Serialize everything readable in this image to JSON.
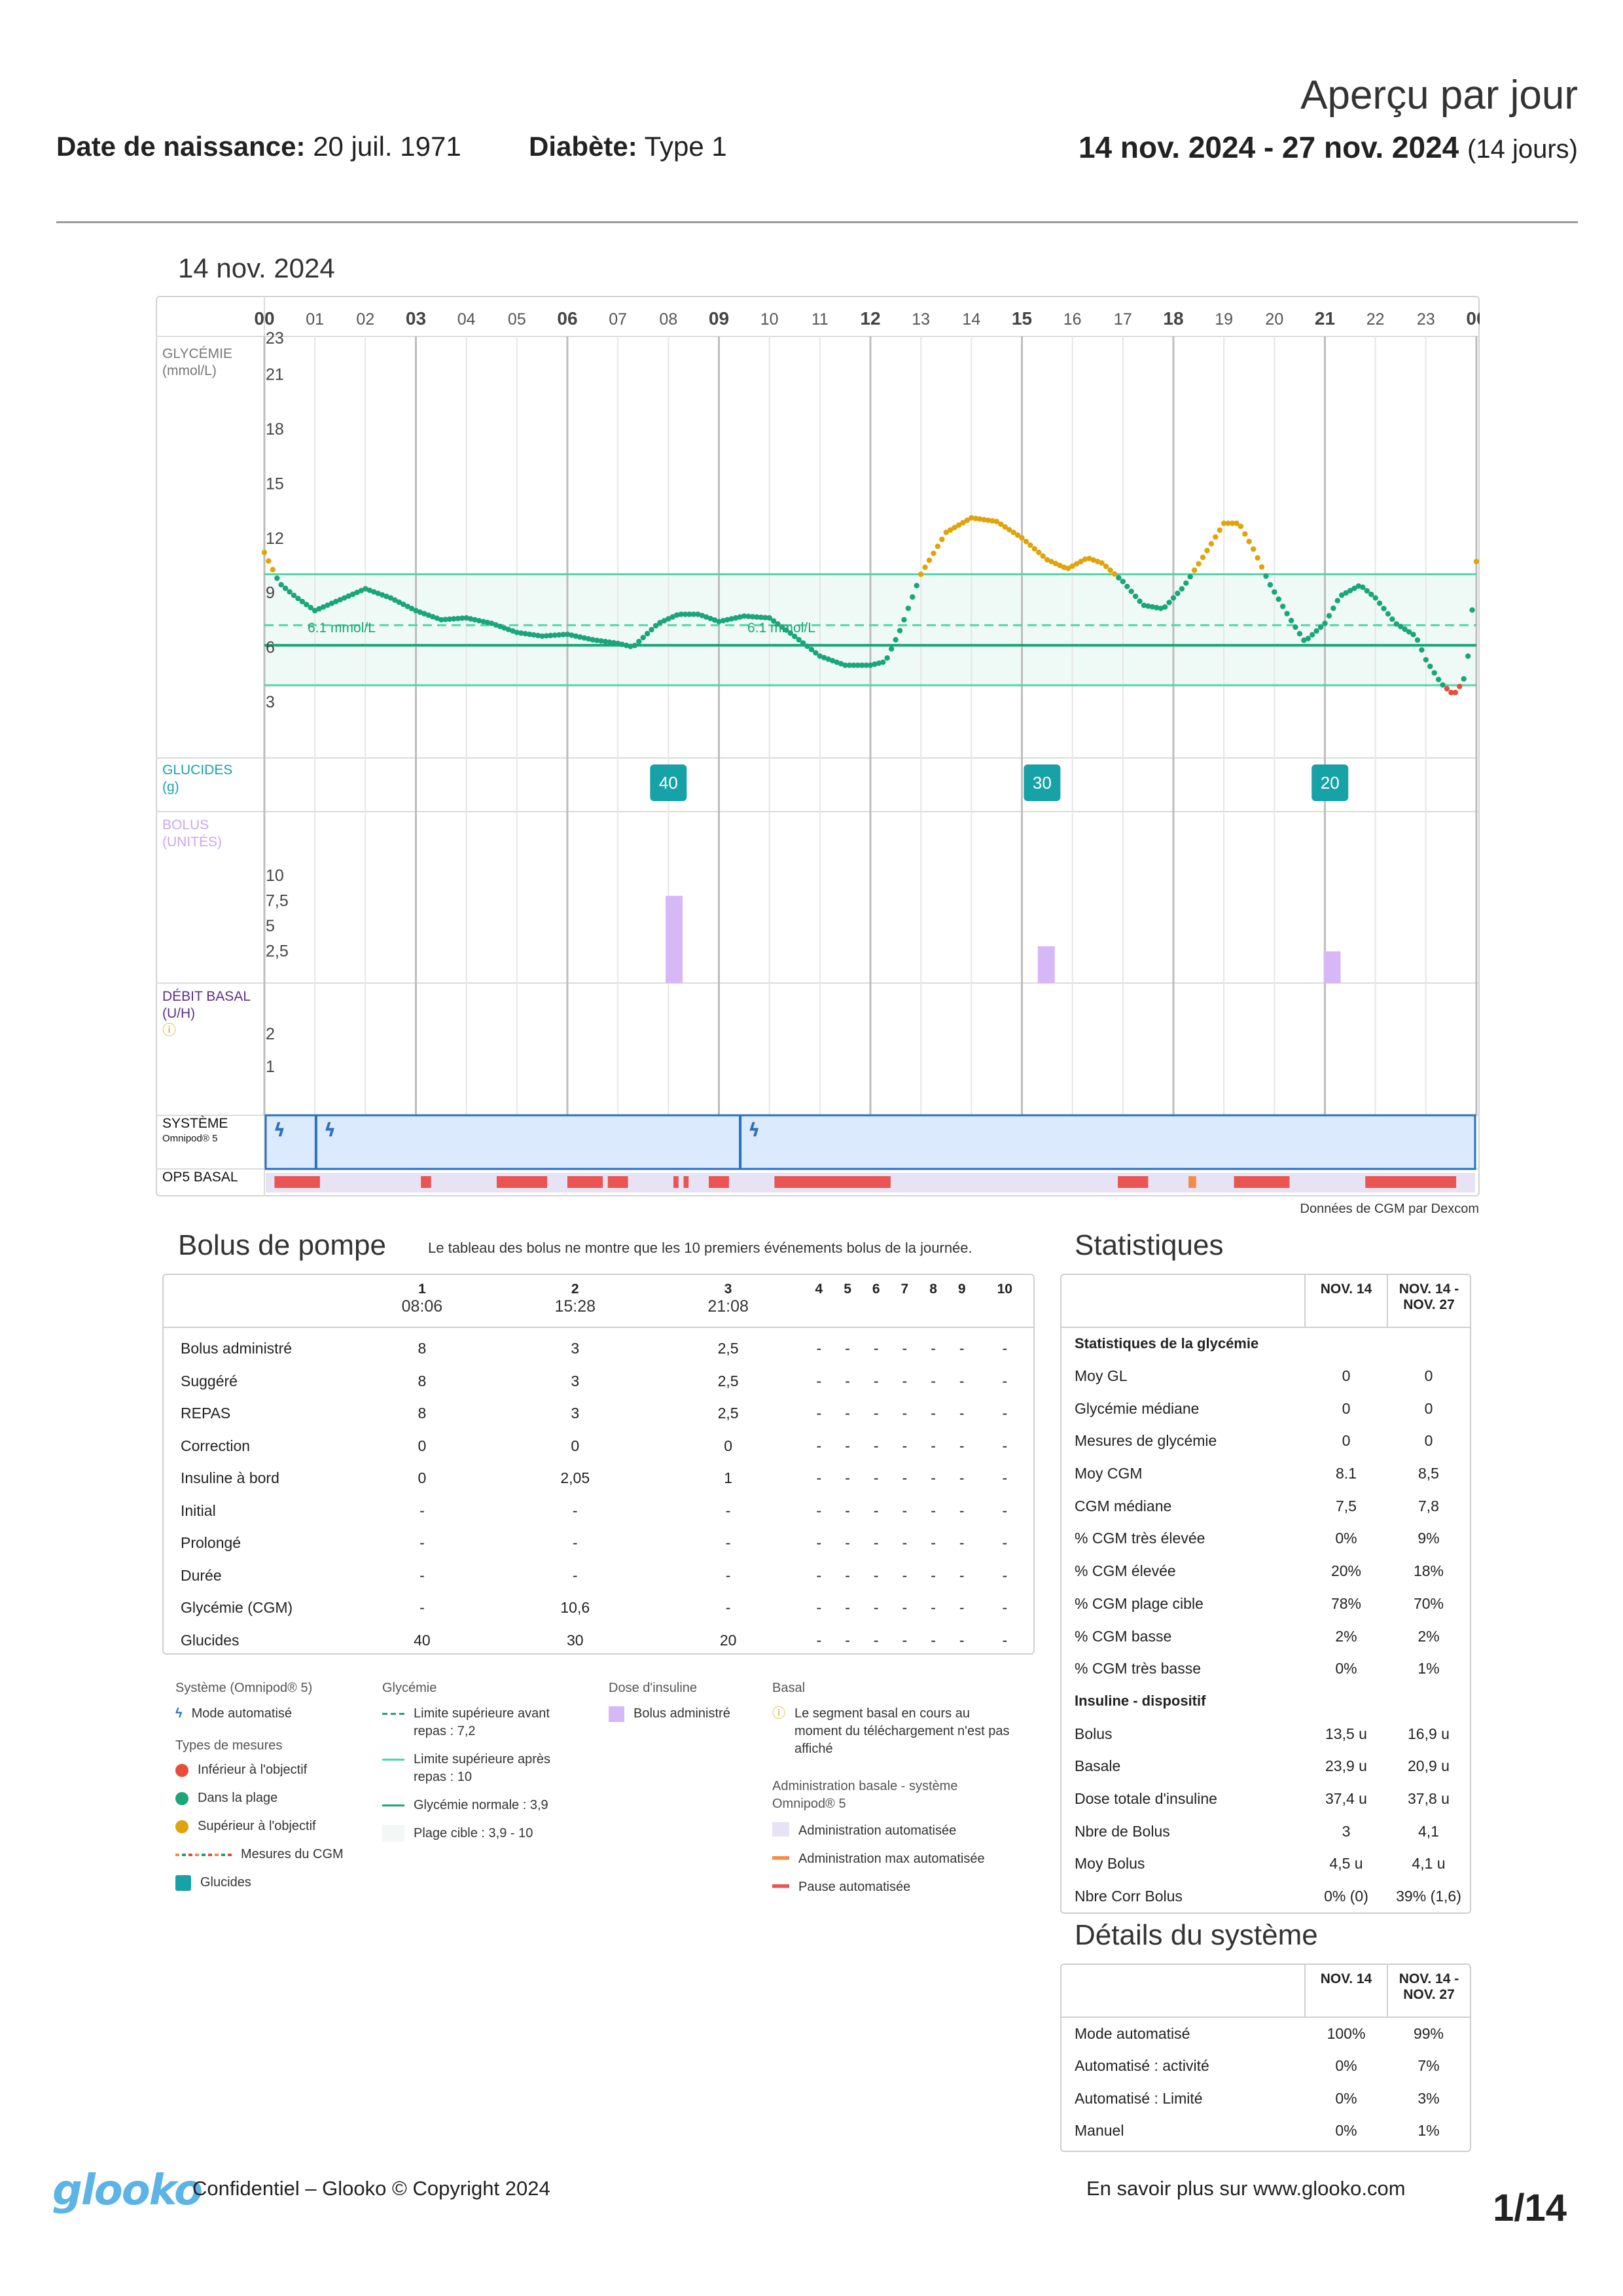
{
  "header": {
    "title": "Aperçu par jour",
    "dob_label": "Date de naissance:",
    "dob_value": "20 juil. 1971",
    "diabetes_label": "Diabète:",
    "diabetes_value": "Type 1",
    "range": "14 nov. 2024 - 27 nov. 2024",
    "range_days": "(14 jours)"
  },
  "day": {
    "title": "14 nov. 2024"
  },
  "chart": {
    "rows": {
      "glycemia": "GLYCÉMIE",
      "glycemia_unit": "(mmol/L)",
      "carbs": "GLUCIDES",
      "carbs_unit": "(g)",
      "bolus": "BOLUS",
      "bolus_unit": "(UNITÉS)",
      "basal": "DÉBIT BASAL",
      "basal_unit": "(U/H)",
      "system": "SYSTÈME",
      "system_sub": "Omnipod® 5",
      "op5": "OP5 BASAL"
    },
    "target_label_1": "6.1 mmol/L",
    "target_label_2": "6.1 mmol/L",
    "source": "Données de CGM par Dexcom",
    "colors": {
      "in_range": "#1aa57a",
      "above": "#e0a30a",
      "below": "#e84c3d",
      "carbs": "#17a2a8",
      "bolus": "#d5b8f5",
      "system": "#dbeafc",
      "system_border": "#2a6fc1",
      "pause": "#ea5452",
      "max": "#f28c46",
      "basal_bg": "#e7e3f4"
    }
  },
  "chart_data": {
    "type": "scatter",
    "x_ticks": [
      "00",
      "01",
      "02",
      "03",
      "04",
      "05",
      "06",
      "07",
      "08",
      "09",
      "10",
      "11",
      "12",
      "13",
      "14",
      "15",
      "16",
      "17",
      "18",
      "19",
      "20",
      "21",
      "22",
      "23",
      "00"
    ],
    "y_ticks": [
      "3",
      "6",
      "9",
      "12",
      "15",
      "18",
      "21",
      "23"
    ],
    "ylim": [
      0,
      23
    ],
    "target_range": [
      3.9,
      10
    ],
    "glucose_curve": [
      [
        0,
        11.2
      ],
      [
        0.3,
        9.5
      ],
      [
        0.6,
        8.8
      ],
      [
        1,
        8
      ],
      [
        1.5,
        8.6
      ],
      [
        2,
        9.2
      ],
      [
        2.5,
        8.7
      ],
      [
        3,
        8
      ],
      [
        3.5,
        7.5
      ],
      [
        4,
        7.6
      ],
      [
        4.5,
        7.3
      ],
      [
        5,
        6.8
      ],
      [
        5.5,
        6.6
      ],
      [
        6,
        6.7
      ],
      [
        6.5,
        6.4
      ],
      [
        7,
        6.2
      ],
      [
        7.3,
        6
      ],
      [
        7.8,
        7.3
      ],
      [
        8.2,
        7.8
      ],
      [
        8.6,
        7.8
      ],
      [
        9,
        7.4
      ],
      [
        9.5,
        7.7
      ],
      [
        10,
        7.6
      ],
      [
        10.4,
        6.8
      ],
      [
        11,
        5.5
      ],
      [
        11.5,
        5
      ],
      [
        12,
        5
      ],
      [
        12.3,
        5.2
      ],
      [
        12.6,
        7
      ],
      [
        13,
        10
      ],
      [
        13.5,
        12.3
      ],
      [
        14,
        13.1
      ],
      [
        14.5,
        12.9
      ],
      [
        15,
        12
      ],
      [
        15.5,
        10.8
      ],
      [
        15.9,
        10.3
      ],
      [
        16.3,
        10.9
      ],
      [
        16.6,
        10.6
      ],
      [
        17,
        9.6
      ],
      [
        17.4,
        8.3
      ],
      [
        17.8,
        8.1
      ],
      [
        18.2,
        9.3
      ],
      [
        18.6,
        11
      ],
      [
        19,
        12.8
      ],
      [
        19.3,
        12.8
      ],
      [
        19.6,
        11.3
      ],
      [
        19.9,
        9.5
      ],
      [
        20.3,
        7.6
      ],
      [
        20.6,
        6.3
      ],
      [
        21,
        7.3
      ],
      [
        21.3,
        8.8
      ],
      [
        21.7,
        9.4
      ],
      [
        22,
        8.7
      ],
      [
        22.4,
        7.3
      ],
      [
        22.8,
        6.6
      ],
      [
        23,
        5.3
      ],
      [
        23.3,
        4
      ],
      [
        23.5,
        3.5
      ],
      [
        23.6,
        3.5
      ],
      [
        23.8,
        4.5
      ],
      [
        23.9,
        7.5
      ],
      [
        24,
        10.7
      ]
    ],
    "carbs": [
      {
        "hour": 8.0,
        "value": "40"
      },
      {
        "hour": 15.4,
        "value": "30"
      },
      {
        "hour": 21.1,
        "value": "20"
      }
    ],
    "bolus_ticks": [
      "10",
      "7,5",
      "5",
      "2,5"
    ],
    "bolus": [
      {
        "hour": 8.1,
        "units": 8
      },
      {
        "hour": 15.47,
        "units": 3
      },
      {
        "hour": 21.13,
        "units": 2.5
      }
    ],
    "basal_ticks": [
      "2",
      "1"
    ],
    "auto_mode_markers": [
      0.1,
      1.1,
      9.5
    ],
    "op5_pauses": [
      [
        0.2,
        1.1
      ],
      [
        3.1,
        3.3
      ],
      [
        4.6,
        5.6
      ],
      [
        6,
        6.7
      ],
      [
        6.8,
        7.2
      ],
      [
        8.1,
        8.2
      ],
      [
        8.3,
        8.4
      ],
      [
        8.8,
        9.2
      ],
      [
        10.1,
        12.4
      ],
      [
        16.9,
        17.5
      ],
      [
        21.8,
        23.6
      ],
      [
        19.2,
        20.3
      ]
    ],
    "op5_max": [
      [
        18.3,
        18.45
      ]
    ]
  },
  "bolus_table": {
    "title": "Bolus de pompe",
    "note": "Le tableau des bolus ne montre que les 10 premiers événements bolus de la journée.",
    "columns": [
      "1",
      "2",
      "3",
      "4",
      "5",
      "6",
      "7",
      "8",
      "9",
      "10"
    ],
    "times": [
      "08:06",
      "15:28",
      "21:08",
      "",
      "",
      "",
      "",
      "",
      "",
      ""
    ],
    "rows": [
      {
        "label": "Bolus administré",
        "values": [
          "8",
          "3",
          "2,5",
          "-",
          "-",
          "-",
          "-",
          "-",
          "-",
          "-"
        ]
      },
      {
        "label": "Suggéré",
        "values": [
          "8",
          "3",
          "2,5",
          "-",
          "-",
          "-",
          "-",
          "-",
          "-",
          "-"
        ]
      },
      {
        "label": "REPAS",
        "values": [
          "8",
          "3",
          "2,5",
          "-",
          "-",
          "-",
          "-",
          "-",
          "-",
          "-"
        ]
      },
      {
        "label": "Correction",
        "values": [
          "0",
          "0",
          "0",
          "-",
          "-",
          "-",
          "-",
          "-",
          "-",
          "-"
        ]
      },
      {
        "label": "Insuline à bord",
        "values": [
          "0",
          "2,05",
          "1",
          "-",
          "-",
          "-",
          "-",
          "-",
          "-",
          "-"
        ]
      },
      {
        "label": "Initial",
        "values": [
          "-",
          "-",
          "-",
          "-",
          "-",
          "-",
          "-",
          "-",
          "-",
          "-"
        ]
      },
      {
        "label": "Prolongé",
        "values": [
          "-",
          "-",
          "-",
          "-",
          "-",
          "-",
          "-",
          "-",
          "-",
          "-"
        ]
      },
      {
        "label": "Durée",
        "values": [
          "-",
          "-",
          "-",
          "-",
          "-",
          "-",
          "-",
          "-",
          "-",
          "-"
        ]
      },
      {
        "label": "Glycémie (CGM)",
        "values": [
          "-",
          "10,6",
          "-",
          "-",
          "-",
          "-",
          "-",
          "-",
          "-",
          "-"
        ]
      },
      {
        "label": "Glucides",
        "values": [
          "40",
          "30",
          "20",
          "-",
          "-",
          "-",
          "-",
          "-",
          "-",
          "-"
        ]
      }
    ]
  },
  "stats": {
    "title": "Statistiques",
    "col1": "NOV. 14",
    "col2a": "NOV. 14 -",
    "col2b": "NOV. 27",
    "rows": [
      {
        "label": "Statistiques de la glycémie",
        "a": "",
        "b": "",
        "head": true
      },
      {
        "label": "Moy GL",
        "a": "0",
        "b": "0"
      },
      {
        "label": "Glycémie médiane",
        "a": "0",
        "b": "0"
      },
      {
        "label": "Mesures de glycémie",
        "a": "0",
        "b": "0"
      },
      {
        "label": "Moy CGM",
        "a": "8.1",
        "b": "8,5"
      },
      {
        "label": "CGM médiane",
        "a": "7,5",
        "b": "7,8"
      },
      {
        "label": "% CGM très élevée",
        "a": "0%",
        "b": "9%"
      },
      {
        "label": "% CGM élevée",
        "a": "20%",
        "b": "18%"
      },
      {
        "label": "% CGM plage cible",
        "a": "78%",
        "b": "70%"
      },
      {
        "label": "% CGM basse",
        "a": "2%",
        "b": "2%"
      },
      {
        "label": "% CGM très basse",
        "a": "0%",
        "b": "1%"
      },
      {
        "label": "Insuline - dispositif",
        "a": "",
        "b": "",
        "head": true
      },
      {
        "label": "Bolus",
        "a": "13,5 u",
        "b": "16,9 u"
      },
      {
        "label": "Basale",
        "a": "23,9 u",
        "b": "20,9 u"
      },
      {
        "label": "Dose totale d'insuline",
        "a": "37,4 u",
        "b": "37,8 u"
      },
      {
        "label": "Nbre de Bolus",
        "a": "3",
        "b": "4,1"
      },
      {
        "label": "Moy Bolus",
        "a": "4,5 u",
        "b": "4,1 u"
      },
      {
        "label": "Nbre Corr Bolus",
        "a": "0% (0)",
        "b": "39% (1,6)"
      }
    ]
  },
  "system_details": {
    "title": "Détails du système",
    "col1": "NOV. 14",
    "col2a": "NOV. 14 -",
    "col2b": "NOV. 27",
    "rows": [
      {
        "label": "Mode automatisé",
        "a": "100%",
        "b": "99%"
      },
      {
        "label": "Automatisé : activité",
        "a": "0%",
        "b": "7%"
      },
      {
        "label": "Automatisé : Limité",
        "a": "0%",
        "b": "3%"
      },
      {
        "label": "Manuel",
        "a": "0%",
        "b": "1%"
      }
    ]
  },
  "legend": {
    "system_h": "Système (Omnipod® 5)",
    "auto_mode": "Mode automatisé",
    "types_h": "Types de mesures",
    "below": "Inférieur à l'objectif",
    "in_range": "Dans la plage",
    "above": "Supérieur à l'objectif",
    "cgm": "Mesures du CGM",
    "carbs": "Glucides",
    "glyc_h": "Glycémie",
    "upper_pre": "Limite supérieure avant repas : 7,2",
    "upper_post": "Limite supérieure après repas : 10",
    "normal": "Glycémie normale : 3,9",
    "target": "Plage cible : 3,9 - 10",
    "dose_h": "Dose d'insuline",
    "bolus_admin": "Bolus administré",
    "basal_h": "Basal",
    "basal_note": "Le segment basal en cours au moment du téléchargement n'est pas affiché",
    "op5_h": "Administration basale - système Omnipod® 5",
    "auto_admin": "Administration automatisée",
    "auto_max": "Administration max automatisée",
    "auto_pause": "Pause automatisée"
  },
  "footer": {
    "logo": "glooko",
    "confidential": "Confidentiel – Glooko © Copyright 2024",
    "more": "En savoir plus sur www.glooko.com",
    "page": "1/14"
  }
}
